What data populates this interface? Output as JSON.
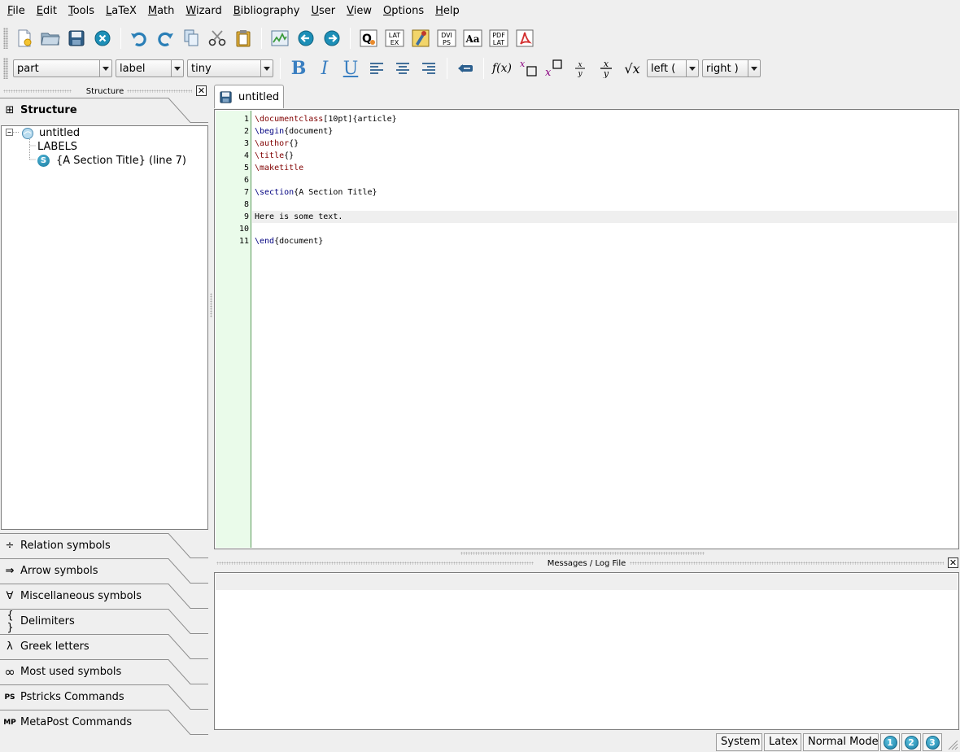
{
  "menubar": {
    "items": [
      "File",
      "Edit",
      "Tools",
      "LaTeX",
      "Math",
      "Wizard",
      "Bibliography",
      "User",
      "View",
      "Options",
      "Help"
    ]
  },
  "toolbar": {
    "latex_icon_text": [
      "LAT",
      "EX"
    ],
    "dvips_icon_text": [
      "DVI",
      "PS"
    ],
    "font_icon_text": "Aa",
    "pdflatex_icon_text": [
      "PDF",
      "LAT"
    ]
  },
  "format_toolbar": {
    "structure_combo": "part",
    "label_combo": "label",
    "size_combo": "tiny",
    "bold_glyph": "B",
    "italic_glyph": "I",
    "underline_glyph": "U",
    "function_glyph": "f(x)",
    "sqrt_glyph": "√x",
    "left_combo": "left (",
    "right_combo": "right )"
  },
  "left_panel": {
    "header_title": "Structure",
    "structure_tab": "Structure",
    "tree": {
      "root": "untitled",
      "labels": "LABELS",
      "section": "{A Section Title} (line 7)",
      "section_badge": "S"
    },
    "tabs": [
      {
        "label": "Relation symbols",
        "icon": "÷"
      },
      {
        "label": "Arrow symbols",
        "icon": "⇒"
      },
      {
        "label": "Miscellaneous symbols",
        "icon": "∀"
      },
      {
        "label": "Delimiters",
        "icon": "{ }"
      },
      {
        "label": "Greek letters",
        "icon": "λ"
      },
      {
        "label": "Most used symbols",
        "icon": "∞"
      },
      {
        "label": "Pstricks Commands",
        "icon": "PS"
      },
      {
        "label": "MetaPost Commands",
        "icon": "MP"
      }
    ]
  },
  "editor": {
    "tab_label": "untitled",
    "current_line": 9,
    "line_numbers": [
      "1",
      "2",
      "3",
      "4",
      "5",
      "6",
      "7",
      "8",
      "9",
      "10",
      "11"
    ],
    "lines": [
      [
        {
          "t": "\\documentclass",
          "c": "kw"
        },
        {
          "t": "[10pt]{article}",
          "c": ""
        }
      ],
      [
        {
          "t": "\\begin",
          "c": "kw-blue"
        },
        {
          "t": "{document}",
          "c": ""
        }
      ],
      [
        {
          "t": "\\author",
          "c": "kw"
        },
        {
          "t": "{}",
          "c": ""
        }
      ],
      [
        {
          "t": "\\title",
          "c": "kw"
        },
        {
          "t": "{}",
          "c": ""
        }
      ],
      [
        {
          "t": "\\maketitle",
          "c": "kw"
        }
      ],
      [],
      [
        {
          "t": "\\section",
          "c": "kw-blue"
        },
        {
          "t": "{A Section Title}",
          "c": ""
        }
      ],
      [],
      [
        {
          "t": "Here is some text.",
          "c": ""
        }
      ],
      [],
      [
        {
          "t": "\\end",
          "c": "kw-blue"
        },
        {
          "t": "{document}",
          "c": ""
        }
      ]
    ]
  },
  "messages": {
    "title": "Messages / Log File"
  },
  "statusbar": {
    "system": "System",
    "latex": "Latex",
    "mode": "Normal Mode",
    "bookmarks": [
      "1",
      "2",
      "3"
    ]
  }
}
